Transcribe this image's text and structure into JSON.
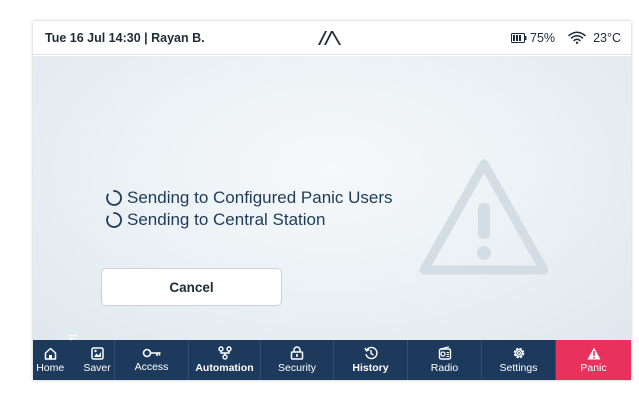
{
  "status": {
    "datetime_user": "Tue 16 Jul 14:30 | Rayan B.",
    "battery": "75%",
    "temperature": "23°C"
  },
  "messages": [
    "Sending to Configured Panic Users",
    "Sending to Central Station"
  ],
  "cancel_label": "Cancel",
  "nav": {
    "home": "Home",
    "saver": "Saver",
    "access": "Access",
    "automation": "Automation",
    "security": "Security",
    "history": "History",
    "radio": "Radio",
    "settings": "Settings",
    "panic": "Panic"
  },
  "colors": {
    "nav_bg": "#1d3a5c",
    "panic_bg": "#e8315c",
    "text_primary": "#1f3b5a"
  },
  "icons": [
    "logo-icon",
    "battery-icon",
    "wifi-icon",
    "spinner-icon",
    "warning-watermark-icon",
    "home-icon",
    "saver-icon",
    "key-icon",
    "automation-icon",
    "lock-icon",
    "history-icon",
    "radio-icon",
    "gear-icon",
    "alert-icon"
  ]
}
